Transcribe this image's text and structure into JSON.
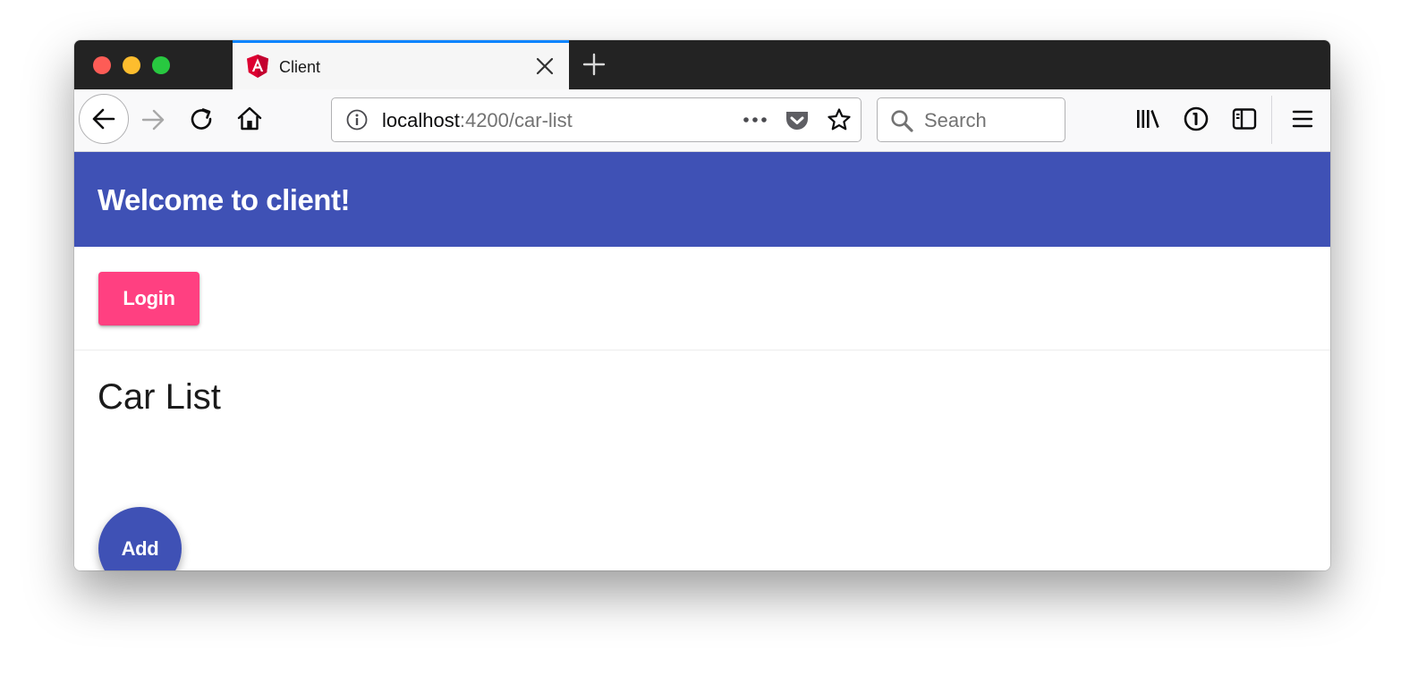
{
  "browser": {
    "tab": {
      "title": "Client",
      "favicon": "angular-icon"
    },
    "address": {
      "host": "localhost",
      "path": ":4200/car-list"
    },
    "search": {
      "placeholder": "Search"
    }
  },
  "app": {
    "toolbar_title": "Welcome to client!",
    "login_label": "Login",
    "section_title": "Car List",
    "add_label": "Add"
  },
  "colors": {
    "primary": "#3f51b5",
    "accent": "#ff4081",
    "tab_highlight": "#0a84ff"
  }
}
